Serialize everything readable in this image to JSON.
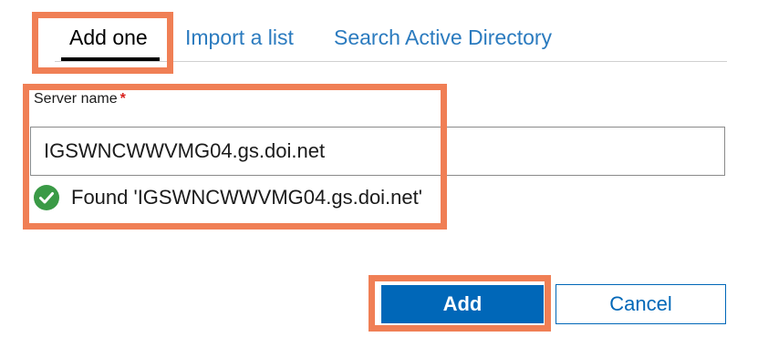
{
  "tabs": {
    "items": [
      {
        "label": "Add one",
        "active": true
      },
      {
        "label": "Import a list",
        "active": false
      },
      {
        "label": "Search Active Directory",
        "active": false
      }
    ]
  },
  "form": {
    "server_name_label": "Server name",
    "required_mark": "*",
    "server_name_value": "IGSWNCWWVMG04.gs.doi.net",
    "validation": {
      "status": "success",
      "icon": "check-circle-icon",
      "message": "Found 'IGSWNCWWVMG04.gs.doi.net'"
    }
  },
  "buttons": {
    "add_label": "Add",
    "cancel_label": "Cancel"
  },
  "colors": {
    "accent": "#0067b8",
    "link": "#2b7bbf",
    "success": "#3a9a46",
    "required": "#d9201c",
    "annotation_highlight": "#f07f55"
  }
}
